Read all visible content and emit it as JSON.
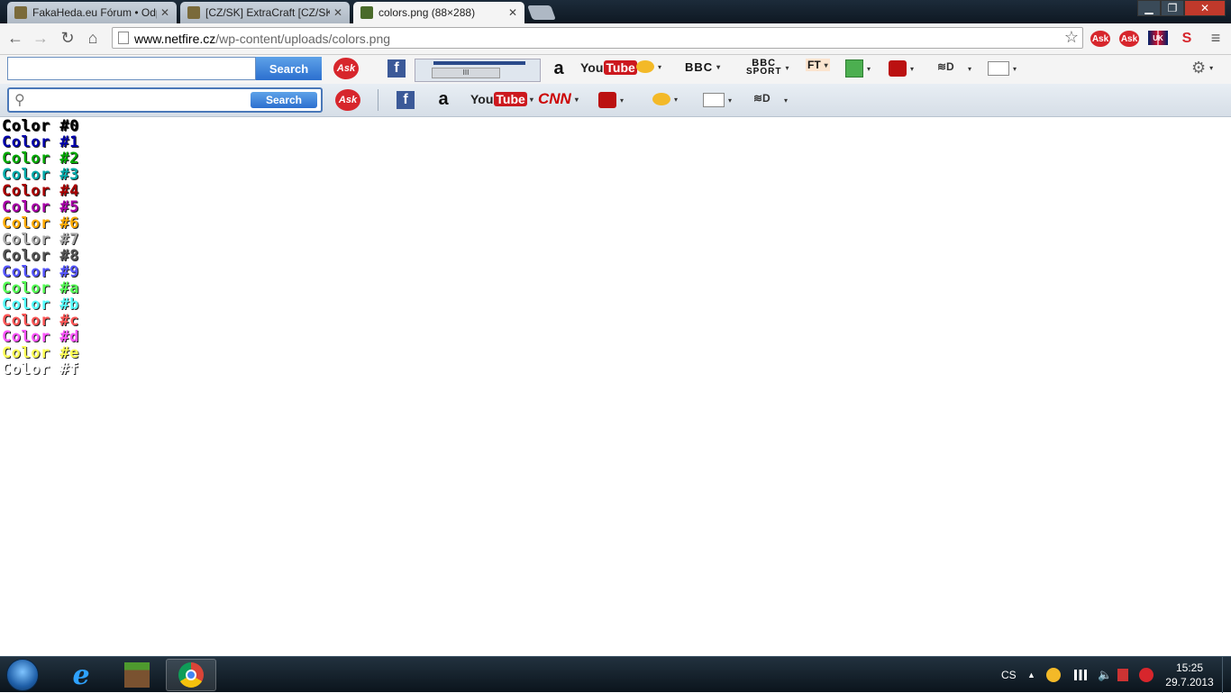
{
  "tabs": [
    {
      "title": "FakaHeda.eu Fórum • Odp",
      "close": "✕",
      "active": false
    },
    {
      "title": "[CZ/SK] ExtraCraft [CZ/SK",
      "close": "✕",
      "active": false
    },
    {
      "title": "colors.png (88×288)",
      "close": "✕",
      "active": true
    }
  ],
  "window_controls": {
    "minimize": "▁",
    "restore": "❐",
    "close": "✕"
  },
  "nav": {
    "back": "←",
    "forward": "→",
    "reload": "↻",
    "home": "⌂",
    "url_host": "www.netfire.cz",
    "url_path": "/wp-content/uploads/colors.png",
    "star": "☆",
    "menu": "≡"
  },
  "extensions": {
    "ask1": "Ask",
    "ask2": "Ask",
    "flag_label": "UK",
    "s_label": "S"
  },
  "toolbar1": {
    "search_value": "",
    "search_button": "Search",
    "ask": "Ask",
    "facebook": "f",
    "amazon": "a",
    "youtube_you": "You",
    "youtube_tube": "Tube",
    "bbc": "BBC",
    "bbc_sport_top": "BBC",
    "bbc_sport_bottom": "SPORT",
    "ft": "FT",
    "mini_scroll": "III",
    "gear": "⚙",
    "caret": "▾"
  },
  "toolbar2": {
    "search_placeholder": "",
    "search_button": "Search",
    "ask": "Ask",
    "facebook": "f",
    "amazon": "a",
    "youtube_you": "You",
    "youtube_tube": "Tube",
    "cnn": "CNN",
    "caret": "▾"
  },
  "content": {
    "rows": [
      {
        "text": "Color #0",
        "color": "#000000"
      },
      {
        "text": "Color #1",
        "color": "#0000aa"
      },
      {
        "text": "Color #2",
        "color": "#00aa00"
      },
      {
        "text": "Color #3",
        "color": "#00aaaa"
      },
      {
        "text": "Color #4",
        "color": "#aa0000"
      },
      {
        "text": "Color #5",
        "color": "#aa00aa"
      },
      {
        "text": "Color #6",
        "color": "#ffaa00"
      },
      {
        "text": "Color #7",
        "color": "#aaaaaa"
      },
      {
        "text": "Color #8",
        "color": "#555555"
      },
      {
        "text": "Color #9",
        "color": "#5555ff"
      },
      {
        "text": "Color #a",
        "color": "#55ff55"
      },
      {
        "text": "Color #b",
        "color": "#55ffff"
      },
      {
        "text": "Color #c",
        "color": "#ff5555"
      },
      {
        "text": "Color #d",
        "color": "#ff55ff"
      },
      {
        "text": "Color #e",
        "color": "#ffff55"
      },
      {
        "text": "Color #f",
        "color": "#ffffff"
      }
    ]
  },
  "taskbar": {
    "language": "CS",
    "tray_arrow": "▲",
    "time": "15:25",
    "date": "29.7.2013",
    "ie_glyph": "e"
  }
}
